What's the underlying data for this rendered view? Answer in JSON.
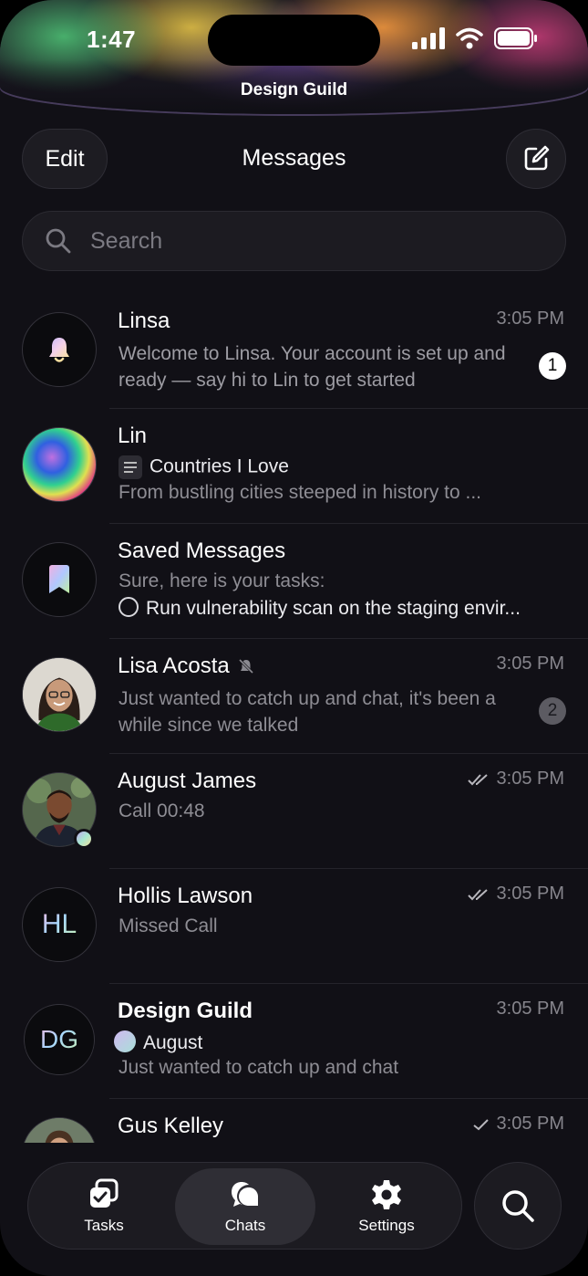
{
  "status": {
    "time": "1:47",
    "group_name": "Design Guild"
  },
  "header": {
    "edit_label": "Edit",
    "title": "Messages"
  },
  "search": {
    "placeholder": "Search"
  },
  "chats": [
    {
      "name": "Linsa",
      "time": "3:05 PM",
      "preview": "Welcome to Linsa. Your account is set up and ready — say hi to Lin to get started",
      "badge": "1"
    },
    {
      "name": "Lin",
      "doc_title": "Countries I Love",
      "preview": "From bustling cities steeped in history to ..."
    },
    {
      "name": "Saved Messages",
      "line1": "Sure, here is your tasks:",
      "task": "Run vulnerability scan on the staging envir..."
    },
    {
      "name": "Lisa Acosta",
      "time": "3:05 PM",
      "preview": "Just wanted to catch up and chat, it's been a while since we talked",
      "badge": "2"
    },
    {
      "name": "August James",
      "time": "3:05 PM",
      "preview": "Call 00:48"
    },
    {
      "name": "Hollis Lawson",
      "initials": "HL",
      "time": "3:05 PM",
      "preview": "Missed Call"
    },
    {
      "name": "Design Guild",
      "initials": "DG",
      "time": "3:05 PM",
      "sender": "August",
      "preview": "Just wanted to catch up and chat"
    },
    {
      "name": "Gus Kelley",
      "time": "3:05 PM"
    }
  ],
  "tabs": [
    {
      "label": "Tasks",
      "icon": "tasks-icon"
    },
    {
      "label": "Chats",
      "icon": "chats-icon",
      "active": true
    },
    {
      "label": "Settings",
      "icon": "settings-icon"
    }
  ],
  "colors": {
    "background": "#111016",
    "surface": "#1c1b21",
    "muted_text": "#8e8d94"
  }
}
